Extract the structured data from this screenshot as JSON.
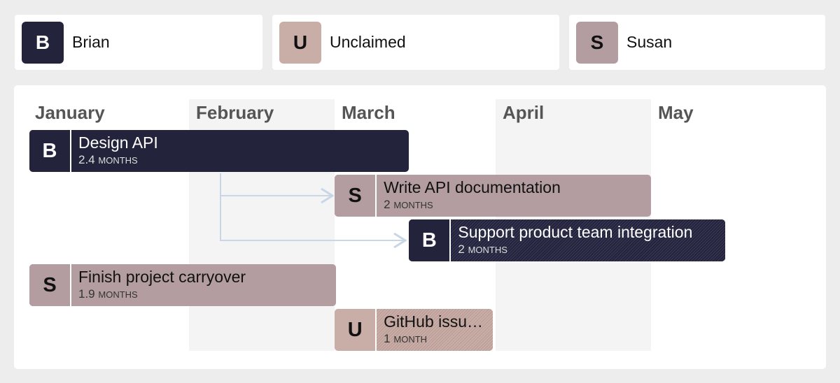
{
  "legend": [
    {
      "initial": "B",
      "name": "Brian",
      "color": "#23233b",
      "text_color": "#ffffff"
    },
    {
      "initial": "U",
      "name": "Unclaimed",
      "color": "#c9ada7",
      "text_color": "#111111"
    },
    {
      "initial": "S",
      "name": "Susan",
      "color": "#b39da0",
      "text_color": "#111111"
    }
  ],
  "timeline": {
    "months": [
      "January",
      "February",
      "March",
      "April",
      "May"
    ],
    "shaded_months": [
      1,
      3
    ],
    "duration_unit_plural": "months",
    "duration_unit_singular": "month"
  },
  "tasks": [
    {
      "id": "design-api",
      "assignee": "B",
      "title": "Design API",
      "duration": "2.4",
      "unit": "months",
      "start_month": 0,
      "length_months": 2.4,
      "row": 0,
      "style": "dark",
      "striped": false
    },
    {
      "id": "write-api-docs",
      "assignee": "S",
      "title": "Write API documentation",
      "duration": "2",
      "unit": "months",
      "start_month": 1.93,
      "length_months": 2,
      "row": 1,
      "style": "rose",
      "striped": false
    },
    {
      "id": "support-integration",
      "assignee": "B",
      "title": "Support product team integration",
      "duration": "2",
      "unit": "months",
      "start_month": 2.4,
      "length_months": 2,
      "row": 2,
      "style": "dark",
      "striped": true
    },
    {
      "id": "finish-carryover",
      "assignee": "S",
      "title": "Finish project carryover",
      "duration": "1.9",
      "unit": "months",
      "start_month": 0,
      "length_months": 1.94,
      "row": 3,
      "style": "rose",
      "striped": false
    },
    {
      "id": "github-issues",
      "assignee": "U",
      "title": "GitHub issu…",
      "duration": "1",
      "unit": "month",
      "start_month": 1.93,
      "length_months": 1,
      "row": 4,
      "style": "peach",
      "striped": true
    }
  ],
  "dependencies": [
    {
      "from": "design-api",
      "to": "write-api-docs"
    },
    {
      "from": "design-api",
      "to": "support-integration"
    }
  ],
  "colors": {
    "page_bg": "#ededed",
    "shaded_column": "#f4f4f4",
    "month_label": "#555555",
    "dependency_line": "#c8d6e5"
  }
}
